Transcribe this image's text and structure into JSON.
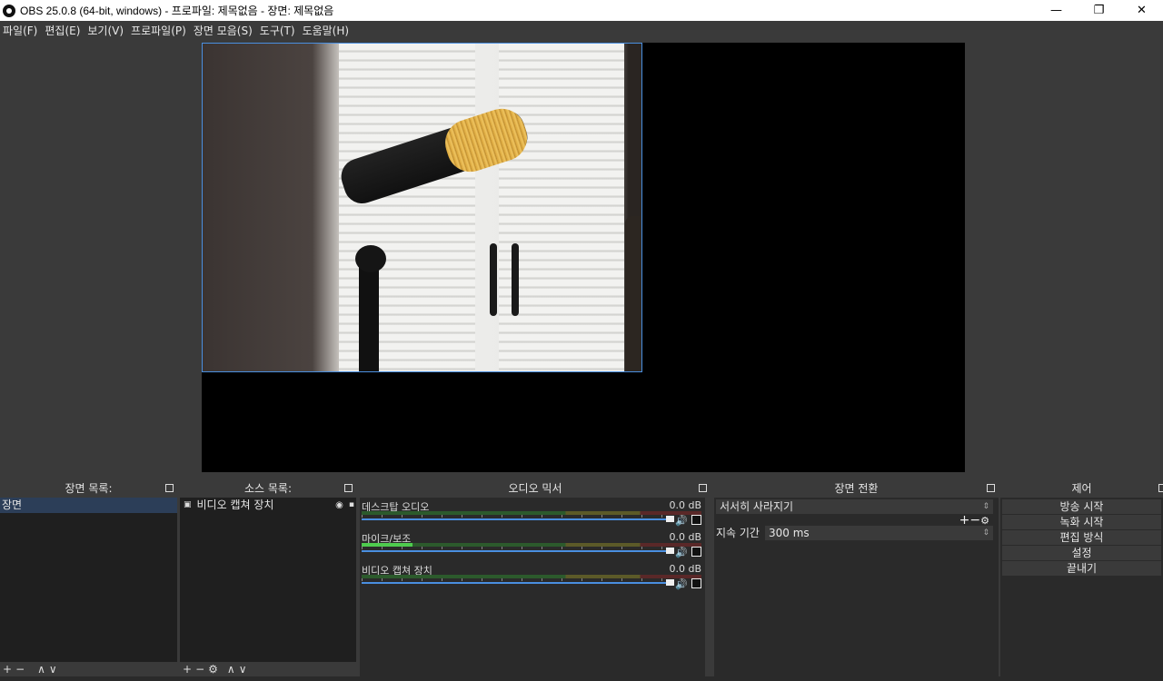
{
  "window": {
    "title": "OBS 25.0.8 (64-bit, windows) - 프로파일: 제목없음 - 장면: 제목없음",
    "minimize": "—",
    "restore": "❐",
    "close": "✕"
  },
  "menu": [
    "파일(F)",
    "편집(E)",
    "보기(V)",
    "프로파일(P)",
    "장면 모음(S)",
    "도구(T)",
    "도움말(H)"
  ],
  "scenes": {
    "header": "장면 목록:",
    "items": [
      "장면"
    ],
    "toolbar": [
      "+",
      "−",
      "∧",
      "∨"
    ]
  },
  "sources": {
    "header": "소스 목록:",
    "items": [
      "비디오 캡쳐 장치"
    ],
    "toolbar": [
      "+",
      "−",
      "⚙",
      "∧",
      "∨"
    ]
  },
  "mixer": {
    "header": "오디오 믹서",
    "tracks": [
      {
        "name": "데스크탑 오디오",
        "db": "0.0 dB",
        "level": 0.0
      },
      {
        "name": "마이크/보조",
        "db": "0.0 dB",
        "level": 0.15
      },
      {
        "name": "비디오 캡쳐 장치",
        "db": "0.0 dB",
        "level": 0.0
      }
    ]
  },
  "transitions": {
    "header": "장면 전환",
    "selected": "서서히 사라지기",
    "buttons": [
      "+",
      "−",
      "⚙"
    ],
    "duration_label": "지속 기간",
    "duration_value": "300 ms"
  },
  "controls": {
    "header": "제어",
    "buttons": [
      "방송 시작",
      "녹화 시작",
      "편집 방식",
      "설정",
      "끝내기"
    ]
  },
  "colors": {
    "accent": "#4a8fe0",
    "selection": "#2c3e58",
    "panel": "#2a2a2a",
    "background": "#3a3a3a"
  }
}
